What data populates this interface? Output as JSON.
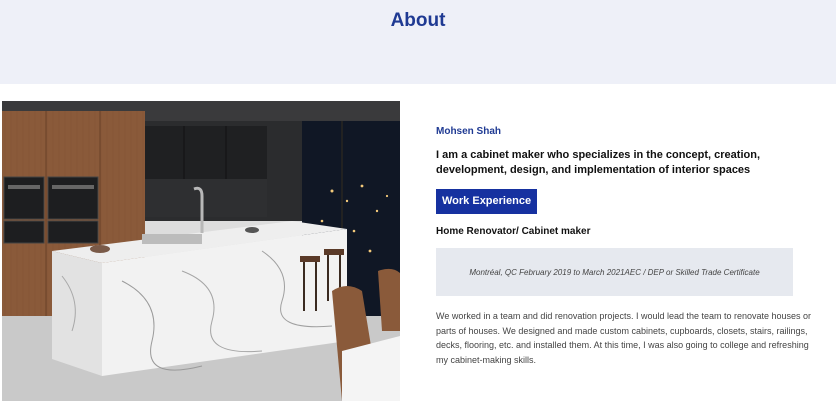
{
  "header": {
    "title": "About"
  },
  "photo": {
    "alt": "modern-kitchen-photo"
  },
  "profile": {
    "name": "Mohsen Shah",
    "headline": "I am a cabinet maker who specializes in the concept, creation, development, design, and implementation of interior spaces",
    "work_button_label": "Work Experience",
    "role": "Home Renovator/ Cabinet maker",
    "certificate": "Montréal, QC February 2019 to March 2021AEC / DEP or Skilled Trade Certificate",
    "description": "We worked in a team and did renovation projects. I would lead the team to renovate houses or parts of houses. We designed and made custom cabinets, cupboards, closets, stairs, railings, decks, flooring, etc. and installed them. At this time, I was also going to college and refreshing my cabinet-making skills."
  },
  "colors": {
    "accent": "#1f3a93",
    "button": "#1631a0",
    "header_bg": "#eef0f8",
    "cert_bg": "#e6e9ef"
  }
}
